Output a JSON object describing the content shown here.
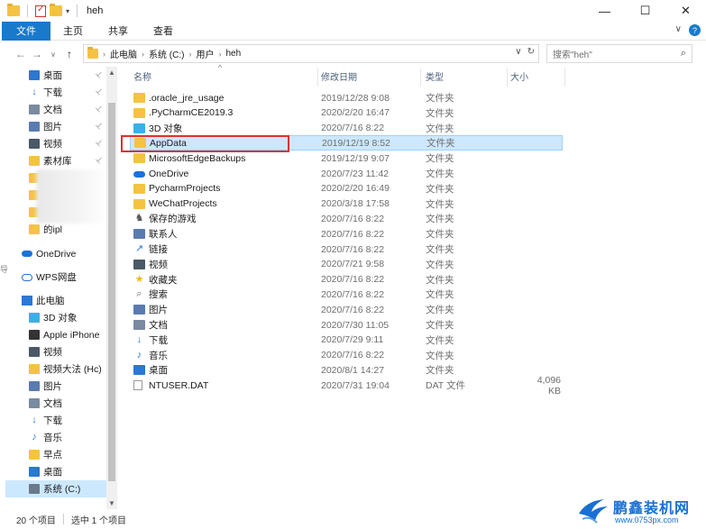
{
  "window": {
    "title": "heh",
    "minimize": "—",
    "maximize": "☐",
    "close": "✕"
  },
  "ribbon": {
    "tabs": [
      "文件",
      "主页",
      "共享",
      "查看"
    ],
    "collapse": "∨",
    "help": "?"
  },
  "nav": {
    "back": "←",
    "forward": "→",
    "recent": "∨",
    "up": "↑",
    "breadcrumb": [
      "此电脑",
      "系统 (C:)",
      "用户",
      "heh"
    ],
    "refresh": "↻",
    "dropdown": "∨",
    "search_placeholder": "搜索\"heh\""
  },
  "sidebar": {
    "quick_access": [
      {
        "label": "桌面",
        "icon": "desktop-icon"
      },
      {
        "label": "下载",
        "icon": "download-icon"
      },
      {
        "label": "文档",
        "icon": "document-icon"
      },
      {
        "label": "图片",
        "icon": "picture-icon"
      },
      {
        "label": "视频",
        "icon": "video-icon"
      },
      {
        "label": "素材库",
        "icon": "folder-icon"
      },
      {
        "label": "",
        "icon": "folder-icon"
      },
      {
        "label": "",
        "icon": "folder-icon"
      },
      {
        "label": "",
        "icon": "folder-icon"
      },
      {
        "label": "的ipl",
        "icon": "folder-icon"
      }
    ],
    "onedrive": "OneDrive",
    "wps": "WPS网盘",
    "this_pc": "此电脑",
    "pc_items": [
      {
        "label": "3D 对象",
        "icon": "3d-objects-icon"
      },
      {
        "label": "Apple iPhone",
        "icon": "phone-icon"
      },
      {
        "label": "视频",
        "icon": "video-icon"
      },
      {
        "label": "视频大法 (Hc)",
        "icon": "folder-icon"
      },
      {
        "label": "图片",
        "icon": "picture-icon"
      },
      {
        "label": "文档",
        "icon": "document-icon"
      },
      {
        "label": "下载",
        "icon": "download-icon"
      },
      {
        "label": "音乐",
        "icon": "music-icon"
      },
      {
        "label": "早点",
        "icon": "folder-icon"
      },
      {
        "label": "桌面",
        "icon": "desktop-icon"
      },
      {
        "label": "系统 (C:)",
        "icon": "drive-icon"
      }
    ],
    "left_edge_char": "导"
  },
  "columns": {
    "name": "名称",
    "date": "修改日期",
    "type": "类型",
    "size": "大小",
    "sort_indicator": "^"
  },
  "files": [
    {
      "name": ".oracle_jre_usage",
      "date": "2019/12/28 9:08",
      "type": "文件夹",
      "size": "",
      "icon": "folder-icon"
    },
    {
      "name": ".PyCharmCE2019.3",
      "date": "2020/2/20 16:47",
      "type": "文件夹",
      "size": "",
      "icon": "folder-icon"
    },
    {
      "name": "3D 对象",
      "date": "2020/7/16 8:22",
      "type": "文件夹",
      "size": "",
      "icon": "3d-objects-icon"
    },
    {
      "name": "AppData",
      "date": "2019/12/19 8:52",
      "type": "文件夹",
      "size": "",
      "icon": "folder-icon"
    },
    {
      "name": "MicrosoftEdgeBackups",
      "date": "2019/12/19 9:07",
      "type": "文件夹",
      "size": "",
      "icon": "folder-icon"
    },
    {
      "name": "OneDrive",
      "date": "2020/7/23 11:42",
      "type": "文件夹",
      "size": "",
      "icon": "onedrive-icon"
    },
    {
      "name": "PycharmProjects",
      "date": "2020/2/20 16:49",
      "type": "文件夹",
      "size": "",
      "icon": "folder-icon"
    },
    {
      "name": "WeChatProjects",
      "date": "2020/3/18 17:58",
      "type": "文件夹",
      "size": "",
      "icon": "folder-icon"
    },
    {
      "name": "保存的游戏",
      "date": "2020/7/16 8:22",
      "type": "文件夹",
      "size": "",
      "icon": "saved-games-icon"
    },
    {
      "name": "联系人",
      "date": "2020/7/16 8:22",
      "type": "文件夹",
      "size": "",
      "icon": "contacts-icon"
    },
    {
      "name": "链接",
      "date": "2020/7/16 8:22",
      "type": "文件夹",
      "size": "",
      "icon": "links-icon"
    },
    {
      "name": "视频",
      "date": "2020/7/21 9:58",
      "type": "文件夹",
      "size": "",
      "icon": "video-icon"
    },
    {
      "name": "收藏夹",
      "date": "2020/7/16 8:22",
      "type": "文件夹",
      "size": "",
      "icon": "favorites-icon"
    },
    {
      "name": "搜索",
      "date": "2020/7/16 8:22",
      "type": "文件夹",
      "size": "",
      "icon": "search-icon"
    },
    {
      "name": "图片",
      "date": "2020/7/16 8:22",
      "type": "文件夹",
      "size": "",
      "icon": "picture-icon"
    },
    {
      "name": "文档",
      "date": "2020/7/30 11:05",
      "type": "文件夹",
      "size": "",
      "icon": "document-icon"
    },
    {
      "name": "下载",
      "date": "2020/7/29 9:11",
      "type": "文件夹",
      "size": "",
      "icon": "download-icon"
    },
    {
      "name": "音乐",
      "date": "2020/7/16 8:22",
      "type": "文件夹",
      "size": "",
      "icon": "music-icon"
    },
    {
      "name": "桌面",
      "date": "2020/8/1 14:27",
      "type": "文件夹",
      "size": "",
      "icon": "desktop-icon"
    },
    {
      "name": "NTUSER.DAT",
      "date": "2020/7/31 19:04",
      "type": "DAT 文件",
      "size": "4,096 KB",
      "icon": "file-icon"
    }
  ],
  "selected_index": 3,
  "status": {
    "count": "20 个项目",
    "selected": "选中 1 个项目"
  },
  "watermark": {
    "brand": "鹏鑫装机网",
    "url": "www.0753px.com"
  },
  "colors": {
    "accent": "#1979ca",
    "selection": "#cce8ff",
    "highlight_box": "#e03030",
    "folder": "#f5c342"
  }
}
